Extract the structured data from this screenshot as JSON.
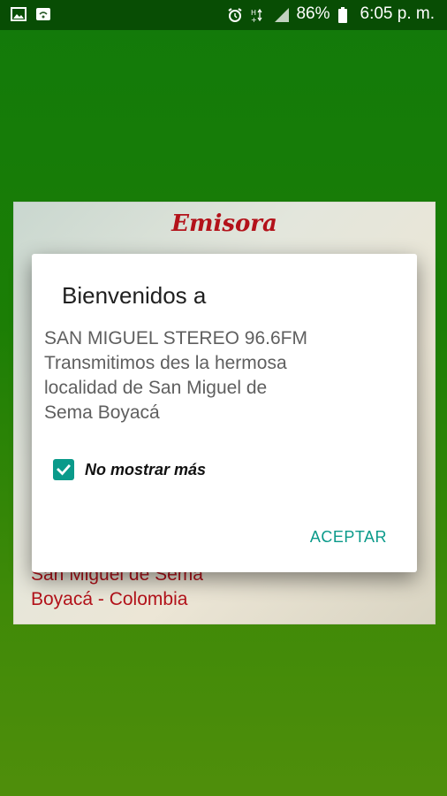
{
  "status_bar": {
    "battery": "86%",
    "time": "6:05 p. m.",
    "icons": [
      "image-icon",
      "wifi-square-icon",
      "alarm-icon",
      "network-type-icon",
      "signal-icon",
      "battery-icon"
    ]
  },
  "banner": {
    "title": "Emisora",
    "location_line1": "San Miguel de Sema",
    "location_line2": "Boyacá - Colombia"
  },
  "dialog": {
    "title": "Bienvenidos a",
    "message_lines": [
      "SAN MIGUEL STEREO 96.6FM",
      "Transmitimos des la hermosa",
      "localidad de San Miguel de",
      "Sema Boyacá"
    ],
    "checkbox_label": "No mostrar más",
    "checkbox_checked": true,
    "accept_label": "ACEPTAR"
  },
  "colors": {
    "accent": "#0a9a8a",
    "banner_red": "#b3121a",
    "background_green": "#1b7e05"
  }
}
